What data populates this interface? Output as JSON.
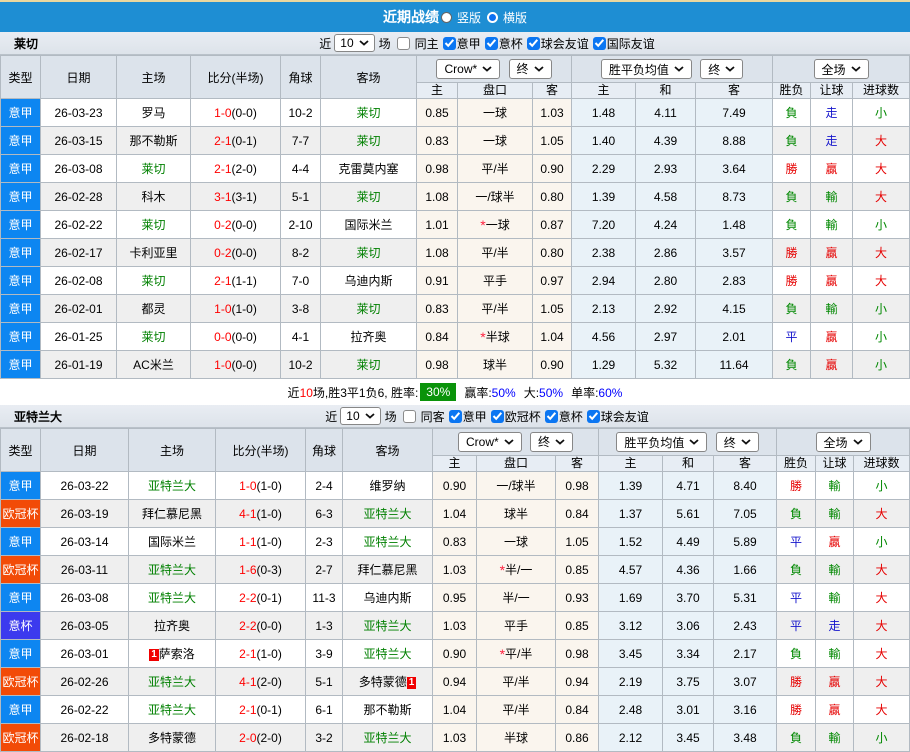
{
  "topbar": {
    "title": "近期战绩",
    "options": [
      {
        "label": "竖版",
        "selected": true
      },
      {
        "label": "横版",
        "selected": false
      }
    ]
  },
  "colors": {
    "topbar_blue": "#1e8ed3",
    "league_blue": "#0d86f1",
    "league_orange": "#f24b07",
    "league_indigo": "#3c3aee",
    "team_highlight_green": "#008000",
    "score_red": "#ff0000",
    "result_red": "#e60000",
    "result_green": "#008800",
    "result_blue": "#1515cc",
    "winrate_badge_green": "#0a930a",
    "summary_value_blue": "#0000ff"
  },
  "table_header": {
    "type": "类型",
    "date": "日期",
    "home": "主场",
    "score": "比分(半场)",
    "corner": "角球",
    "away": "客场",
    "selects": {
      "bookmaker": "Crow*",
      "final1": "终",
      "europe": "胜平负均值",
      "final2": "终",
      "scope": "全场"
    },
    "sub": {
      "asian_home": "主",
      "handicap": "盘口",
      "asian_away": "客",
      "europe_home": "主",
      "europe_draw": "和",
      "europe_away": "客",
      "result": "胜负",
      "handicap_result": "让球",
      "goals": "进球数"
    }
  },
  "sections": [
    {
      "team": "莱切",
      "filter": {
        "near": "近",
        "count": "10",
        "games": "场",
        "same_label": "同主",
        "same_checked": false,
        "leagues": [
          {
            "label": "意甲",
            "checked": true
          },
          {
            "label": "意杯",
            "checked": true
          },
          {
            "label": "球会友谊",
            "checked": true
          },
          {
            "label": "国际友谊",
            "checked": true
          }
        ]
      },
      "rows": [
        {
          "league": "意甲",
          "league_color": "blue",
          "date": "26-03-23",
          "home": "罗马",
          "home_hl": false,
          "home_card": false,
          "score": "1-0",
          "half": "(0-0)",
          "corner": "10-2",
          "away": "莱切",
          "away_hl": true,
          "away_card": false,
          "asian": [
            "0.85",
            "一球",
            "1.03"
          ],
          "star": false,
          "europe": [
            "1.48",
            "4.11",
            "7.49"
          ],
          "outcome": [
            "負",
            "green"
          ],
          "handicap": [
            "走",
            "blue"
          ],
          "goals": [
            "小",
            "green"
          ]
        },
        {
          "league": "意甲",
          "league_color": "blue",
          "date": "26-03-15",
          "home": "那不勒斯",
          "home_hl": false,
          "home_card": false,
          "score": "2-1",
          "half": "(0-1)",
          "corner": "7-7",
          "away": "莱切",
          "away_hl": true,
          "away_card": false,
          "asian": [
            "0.83",
            "一球",
            "1.05"
          ],
          "star": false,
          "europe": [
            "1.40",
            "4.39",
            "8.88"
          ],
          "outcome": [
            "負",
            "green"
          ],
          "handicap": [
            "走",
            "blue"
          ],
          "goals": [
            "大",
            "red"
          ]
        },
        {
          "league": "意甲",
          "league_color": "blue",
          "date": "26-03-08",
          "home": "莱切",
          "home_hl": true,
          "home_card": false,
          "score": "2-1",
          "half": "(2-0)",
          "corner": "4-4",
          "away": "克雷莫内塞",
          "away_hl": false,
          "away_card": false,
          "asian": [
            "0.98",
            "平/半",
            "0.90"
          ],
          "star": false,
          "europe": [
            "2.29",
            "2.93",
            "3.64"
          ],
          "outcome": [
            "勝",
            "red"
          ],
          "handicap": [
            "贏",
            "red"
          ],
          "goals": [
            "大",
            "red"
          ]
        },
        {
          "league": "意甲",
          "league_color": "blue",
          "date": "26-02-28",
          "home": "科木",
          "home_hl": false,
          "home_card": false,
          "score": "3-1",
          "half": "(3-1)",
          "corner": "5-1",
          "away": "莱切",
          "away_hl": true,
          "away_card": false,
          "asian": [
            "1.08",
            "一/球半",
            "0.80"
          ],
          "star": false,
          "europe": [
            "1.39",
            "4.58",
            "8.73"
          ],
          "outcome": [
            "負",
            "green"
          ],
          "handicap": [
            "輸",
            "green"
          ],
          "goals": [
            "大",
            "red"
          ]
        },
        {
          "league": "意甲",
          "league_color": "blue",
          "date": "26-02-22",
          "home": "莱切",
          "home_hl": true,
          "home_card": false,
          "score": "0-2",
          "half": "(0-0)",
          "corner": "2-10",
          "away": "国际米兰",
          "away_hl": false,
          "away_card": false,
          "asian": [
            "1.01",
            "一球",
            "0.87"
          ],
          "star": true,
          "europe": [
            "7.20",
            "4.24",
            "1.48"
          ],
          "outcome": [
            "負",
            "green"
          ],
          "handicap": [
            "輸",
            "green"
          ],
          "goals": [
            "小",
            "green"
          ]
        },
        {
          "league": "意甲",
          "league_color": "blue",
          "date": "26-02-17",
          "home": "卡利亚里",
          "home_hl": false,
          "home_card": false,
          "score": "0-2",
          "half": "(0-0)",
          "corner": "8-2",
          "away": "莱切",
          "away_hl": true,
          "away_card": false,
          "asian": [
            "1.08",
            "平/半",
            "0.80"
          ],
          "star": false,
          "europe": [
            "2.38",
            "2.86",
            "3.57"
          ],
          "outcome": [
            "勝",
            "red"
          ],
          "handicap": [
            "贏",
            "red"
          ],
          "goals": [
            "大",
            "red"
          ]
        },
        {
          "league": "意甲",
          "league_color": "blue",
          "date": "26-02-08",
          "home": "莱切",
          "home_hl": true,
          "home_card": false,
          "score": "2-1",
          "half": "(1-1)",
          "corner": "7-0",
          "away": "乌迪内斯",
          "away_hl": false,
          "away_card": false,
          "asian": [
            "0.91",
            "平手",
            "0.97"
          ],
          "star": false,
          "europe": [
            "2.94",
            "2.80",
            "2.83"
          ],
          "outcome": [
            "勝",
            "red"
          ],
          "handicap": [
            "贏",
            "red"
          ],
          "goals": [
            "大",
            "red"
          ]
        },
        {
          "league": "意甲",
          "league_color": "blue",
          "date": "26-02-01",
          "home": "都灵",
          "home_hl": false,
          "home_card": false,
          "score": "1-0",
          "half": "(1-0)",
          "corner": "3-8",
          "away": "莱切",
          "away_hl": true,
          "away_card": false,
          "asian": [
            "0.83",
            "平/半",
            "1.05"
          ],
          "star": false,
          "europe": [
            "2.13",
            "2.92",
            "4.15"
          ],
          "outcome": [
            "負",
            "green"
          ],
          "handicap": [
            "輸",
            "green"
          ],
          "goals": [
            "小",
            "green"
          ]
        },
        {
          "league": "意甲",
          "league_color": "blue",
          "date": "26-01-25",
          "home": "莱切",
          "home_hl": true,
          "home_card": false,
          "score": "0-0",
          "half": "(0-0)",
          "corner": "4-1",
          "away": "拉齐奥",
          "away_hl": false,
          "away_card": false,
          "asian": [
            "0.84",
            "半球",
            "1.04"
          ],
          "star": true,
          "europe": [
            "4.56",
            "2.97",
            "2.01"
          ],
          "outcome": [
            "平",
            "blue"
          ],
          "handicap": [
            "贏",
            "red"
          ],
          "goals": [
            "小",
            "green"
          ]
        },
        {
          "league": "意甲",
          "league_color": "blue",
          "date": "26-01-19",
          "home": "AC米兰",
          "home_hl": false,
          "home_card": false,
          "score": "1-0",
          "half": "(0-0)",
          "corner": "10-2",
          "away": "莱切",
          "away_hl": true,
          "away_card": false,
          "asian": [
            "0.98",
            "球半",
            "0.90"
          ],
          "star": false,
          "europe": [
            "1.29",
            "5.32",
            "11.64"
          ],
          "outcome": [
            "負",
            "green"
          ],
          "handicap": [
            "贏",
            "red"
          ],
          "goals": [
            "小",
            "green"
          ]
        }
      ],
      "summary": {
        "near": "近",
        "count": "10",
        "record": "场,胜3平1负6, 胜率:",
        "win_rate": "30%",
        "parts": [
          {
            "label": "赢率:",
            "value": "50%"
          },
          {
            "label": "大:",
            "value": "50%"
          },
          {
            "label": "单率:",
            "value": "60%"
          }
        ]
      }
    },
    {
      "team": "亚特兰大",
      "filter": {
        "near": "近",
        "count": "10",
        "games": "场",
        "same_label": "同客",
        "same_checked": false,
        "leagues": [
          {
            "label": "意甲",
            "checked": true
          },
          {
            "label": "欧冠杯",
            "checked": true
          },
          {
            "label": "意杯",
            "checked": true
          },
          {
            "label": "球会友谊",
            "checked": true
          }
        ]
      },
      "rows": [
        {
          "league": "意甲",
          "league_color": "blue",
          "date": "26-03-22",
          "home": "亚特兰大",
          "home_hl": true,
          "home_card": false,
          "score": "1-0",
          "half": "(1-0)",
          "corner": "2-4",
          "away": "维罗纳",
          "away_hl": false,
          "away_card": false,
          "asian": [
            "0.90",
            "一/球半",
            "0.98"
          ],
          "star": false,
          "europe": [
            "1.39",
            "4.71",
            "8.40"
          ],
          "outcome": [
            "勝",
            "red"
          ],
          "handicap": [
            "輸",
            "green"
          ],
          "goals": [
            "小",
            "green"
          ]
        },
        {
          "league": "欧冠杯",
          "league_color": "orange",
          "date": "26-03-19",
          "home": "拜仁慕尼黑",
          "home_hl": false,
          "home_card": false,
          "score": "4-1",
          "half": "(1-0)",
          "corner": "6-3",
          "away": "亚特兰大",
          "away_hl": true,
          "away_card": false,
          "asian": [
            "1.04",
            "球半",
            "0.84"
          ],
          "star": false,
          "europe": [
            "1.37",
            "5.61",
            "7.05"
          ],
          "outcome": [
            "負",
            "green"
          ],
          "handicap": [
            "輸",
            "green"
          ],
          "goals": [
            "大",
            "red"
          ]
        },
        {
          "league": "意甲",
          "league_color": "blue",
          "date": "26-03-14",
          "home": "国际米兰",
          "home_hl": false,
          "home_card": false,
          "score": "1-1",
          "half": "(1-0)",
          "corner": "2-3",
          "away": "亚特兰大",
          "away_hl": true,
          "away_card": false,
          "asian": [
            "0.83",
            "一球",
            "1.05"
          ],
          "star": false,
          "europe": [
            "1.52",
            "4.49",
            "5.89"
          ],
          "outcome": [
            "平",
            "blue"
          ],
          "handicap": [
            "贏",
            "red"
          ],
          "goals": [
            "小",
            "green"
          ]
        },
        {
          "league": "欧冠杯",
          "league_color": "orange",
          "date": "26-03-11",
          "home": "亚特兰大",
          "home_hl": true,
          "home_card": false,
          "score": "1-6",
          "half": "(0-3)",
          "corner": "2-7",
          "away": "拜仁慕尼黑",
          "away_hl": false,
          "away_card": false,
          "asian": [
            "1.03",
            "半/一",
            "0.85"
          ],
          "star": true,
          "europe": [
            "4.57",
            "4.36",
            "1.66"
          ],
          "outcome": [
            "負",
            "green"
          ],
          "handicap": [
            "輸",
            "green"
          ],
          "goals": [
            "大",
            "red"
          ]
        },
        {
          "league": "意甲",
          "league_color": "blue",
          "date": "26-03-08",
          "home": "亚特兰大",
          "home_hl": true,
          "home_card": false,
          "score": "2-2",
          "half": "(0-1)",
          "corner": "11-3",
          "away": "乌迪内斯",
          "away_hl": false,
          "away_card": false,
          "asian": [
            "0.95",
            "半/一",
            "0.93"
          ],
          "star": false,
          "europe": [
            "1.69",
            "3.70",
            "5.31"
          ],
          "outcome": [
            "平",
            "blue"
          ],
          "handicap": [
            "輸",
            "green"
          ],
          "goals": [
            "大",
            "red"
          ]
        },
        {
          "league": "意杯",
          "league_color": "indigo",
          "date": "26-03-05",
          "home": "拉齐奥",
          "home_hl": false,
          "home_card": false,
          "score": "2-2",
          "half": "(0-0)",
          "corner": "1-3",
          "away": "亚特兰大",
          "away_hl": true,
          "away_card": false,
          "asian": [
            "1.03",
            "平手",
            "0.85"
          ],
          "star": false,
          "europe": [
            "3.12",
            "3.06",
            "2.43"
          ],
          "outcome": [
            "平",
            "blue"
          ],
          "handicap": [
            "走",
            "blue"
          ],
          "goals": [
            "大",
            "red"
          ]
        },
        {
          "league": "意甲",
          "league_color": "blue",
          "date": "26-03-01",
          "home": "萨索洛",
          "home_hl": false,
          "home_card": true,
          "score": "2-1",
          "half": "(1-0)",
          "corner": "3-9",
          "away": "亚特兰大",
          "away_hl": true,
          "away_card": false,
          "asian": [
            "0.90",
            "平/半",
            "0.98"
          ],
          "star": true,
          "europe": [
            "3.45",
            "3.34",
            "2.17"
          ],
          "outcome": [
            "負",
            "green"
          ],
          "handicap": [
            "輸",
            "green"
          ],
          "goals": [
            "大",
            "red"
          ]
        },
        {
          "league": "欧冠杯",
          "league_color": "orange",
          "date": "26-02-26",
          "home": "亚特兰大",
          "home_hl": true,
          "home_card": false,
          "score": "4-1",
          "half": "(2-0)",
          "corner": "5-1",
          "away": "多特蒙德",
          "away_hl": false,
          "away_card": true,
          "asian": [
            "0.94",
            "平/半",
            "0.94"
          ],
          "star": false,
          "europe": [
            "2.19",
            "3.75",
            "3.07"
          ],
          "outcome": [
            "勝",
            "red"
          ],
          "handicap": [
            "贏",
            "red"
          ],
          "goals": [
            "大",
            "red"
          ]
        },
        {
          "league": "意甲",
          "league_color": "blue",
          "date": "26-02-22",
          "home": "亚特兰大",
          "home_hl": true,
          "home_card": false,
          "score": "2-1",
          "half": "(0-1)",
          "corner": "6-1",
          "away": "那不勒斯",
          "away_hl": false,
          "away_card": false,
          "asian": [
            "1.04",
            "平/半",
            "0.84"
          ],
          "star": false,
          "europe": [
            "2.48",
            "3.01",
            "3.16"
          ],
          "outcome": [
            "勝",
            "red"
          ],
          "handicap": [
            "贏",
            "red"
          ],
          "goals": [
            "大",
            "red"
          ]
        },
        {
          "league": "欧冠杯",
          "league_color": "orange",
          "date": "26-02-18",
          "home": "多特蒙德",
          "home_hl": false,
          "home_card": false,
          "score": "2-0",
          "half": "(2-0)",
          "corner": "3-2",
          "away": "亚特兰大",
          "away_hl": true,
          "away_card": false,
          "asian": [
            "1.03",
            "半球",
            "0.86"
          ],
          "star": false,
          "europe": [
            "2.12",
            "3.45",
            "3.48"
          ],
          "outcome": [
            "負",
            "green"
          ],
          "handicap": [
            "輸",
            "green"
          ],
          "goals": [
            "小",
            "green"
          ]
        }
      ],
      "summary": null
    }
  ],
  "red_card_badge": "1"
}
